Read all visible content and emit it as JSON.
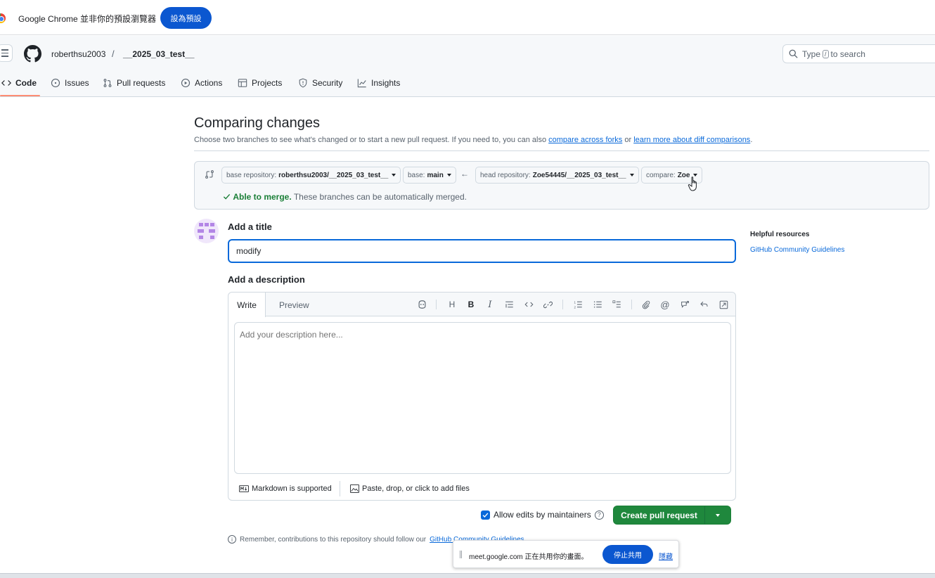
{
  "chrome_infobar": {
    "message": "Google Chrome 並非你的預設瀏覽器",
    "button": "設為預設"
  },
  "header": {
    "owner": "roberthsu2003",
    "separator": "/",
    "repo": "__2025_03_test__",
    "search_prefix": "Type",
    "search_key": "/",
    "search_suffix": "to search"
  },
  "repo_nav": [
    {
      "label": "Code",
      "icon": "code-icon",
      "selected": true
    },
    {
      "label": "Issues",
      "icon": "issue-opened-icon"
    },
    {
      "label": "Pull requests",
      "icon": "git-pull-request-icon"
    },
    {
      "label": "Actions",
      "icon": "play-icon"
    },
    {
      "label": "Projects",
      "icon": "table-icon"
    },
    {
      "label": "Security",
      "icon": "shield-icon"
    },
    {
      "label": "Insights",
      "icon": "graph-icon"
    }
  ],
  "compare": {
    "title": "Comparing changes",
    "subtitle_prefix": "Choose two branches to see what's changed or to start a new pull request. If you need to, you can also",
    "link_forks": "compare across forks",
    "subtitle_or": "or",
    "link_learn": "learn more about diff comparisons",
    "subtitle_end": ".",
    "base_repo_label": "base repository:",
    "base_repo_value": "roberthsu2003/__2025_03_test__",
    "base_label": "base:",
    "base_value": "main",
    "head_repo_label": "head repository:",
    "head_repo_value": "Zoe54445/__2025_03_test__",
    "compare_label": "compare:",
    "compare_value": "Zoe",
    "merge_status": "Able to merge.",
    "merge_detail": "These branches can be automatically merged."
  },
  "form": {
    "title_label": "Add a title",
    "title_value": "modify",
    "desc_label": "Add a description",
    "tab_write": "Write",
    "tab_preview": "Preview",
    "desc_placeholder": "Add your description here...",
    "markdown_note": "Markdown is supported",
    "files_note": "Paste, drop, or click to add files",
    "allow_edits": "Allow edits by maintainers",
    "allow_edits_checked": true,
    "create_button": "Create pull request",
    "reminder_prefix": "Remember, contributions to this repository should follow our",
    "reminder_link": "GitHub Community Guidelines"
  },
  "sidebar": {
    "heading": "Helpful resources",
    "link": "GitHub Community Guidelines"
  },
  "meet_bar": {
    "message": "meet.google.com 正在共用你的畫面。",
    "stop": "停止共用",
    "hide": "隱藏"
  },
  "colors": {
    "accent_blue": "#0969da",
    "merge_green": "#1a7f37",
    "create_button_green": "#1f883d",
    "chrome_blue": "#0b57d0",
    "nav_underline": "#fd8c73"
  }
}
